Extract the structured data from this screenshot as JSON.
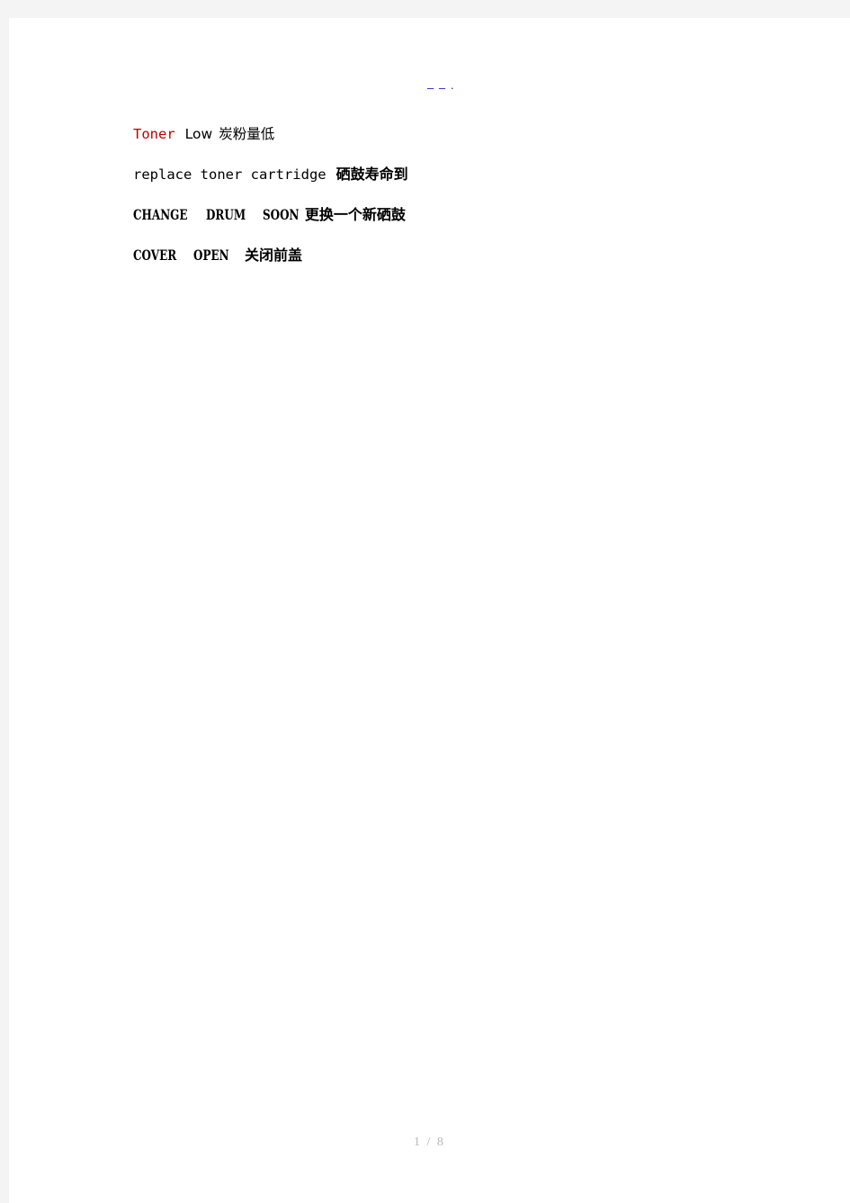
{
  "document": {
    "header_mark": "– – ·",
    "lines": [
      {
        "id": "toner-low",
        "runs": [
          {
            "text": "Toner",
            "style": "mono-red"
          },
          {
            "text": "Low",
            "style": "sans-latin"
          },
          {
            "text": "炭粉量低",
            "style": "cjk-regular"
          }
        ]
      },
      {
        "id": "replace-toner-cartridge",
        "runs": [
          {
            "text": "replace toner cartridge",
            "style": "mono"
          },
          {
            "text": "硒鼓寿命到",
            "style": "cjk-bold"
          }
        ]
      },
      {
        "id": "change-drum-soon",
        "runs": [
          {
            "text": "CHANGE",
            "style": "caps"
          },
          {
            "text": "DRUM",
            "style": "caps"
          },
          {
            "text": "SOON",
            "style": "caps"
          },
          {
            "text": "更换一个新硒鼓",
            "style": "cjk-plain"
          }
        ]
      },
      {
        "id": "cover-open",
        "runs": [
          {
            "text": "COVER",
            "style": "caps"
          },
          {
            "text": "OPEN",
            "style": "caps"
          },
          {
            "text": "关闭前盖",
            "style": "cjk-plain"
          }
        ]
      }
    ]
  },
  "footer": {
    "page_indicator": "1 / 8",
    "current_page": "1",
    "separator": "/",
    "total_pages": "8"
  },
  "colors": {
    "canvas_background": "#f4f4f4",
    "page_background": "#ffffff",
    "accent_red": "#c00000",
    "header_mark_blue": "#1414d2",
    "footer_gray": "#b9b9b9",
    "body_text": "#000000"
  }
}
